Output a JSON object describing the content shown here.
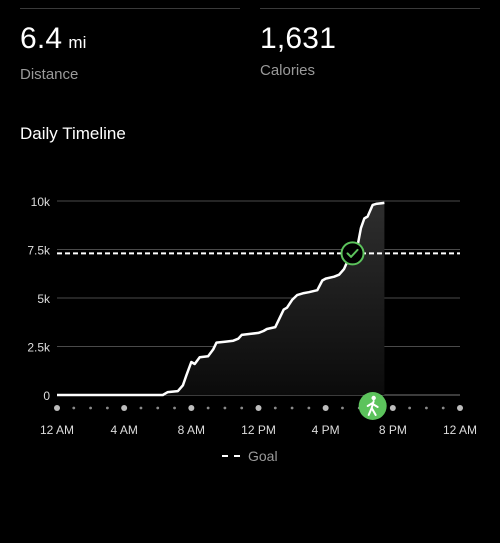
{
  "stats": {
    "distance": {
      "value": "6.4",
      "unit": "mi",
      "label": "Distance"
    },
    "calories": {
      "value": "1,631",
      "label": "Calories"
    }
  },
  "section_title": "Daily Timeline",
  "legend": {
    "goal_label": "Goal"
  },
  "icons": {
    "goal_reached": "check-circle-icon",
    "activity": "walking-icon"
  },
  "colors": {
    "accent": "#5cc35c",
    "line": "#ffffff",
    "grid": "#4a4a4a",
    "muted": "#9a9a9a"
  },
  "chart_data": {
    "type": "area",
    "x_ticks": [
      "12 AM",
      "4 AM",
      "8 AM",
      "12 PM",
      "4 PM",
      "8 PM",
      "12 AM"
    ],
    "x_tick_hours": [
      0,
      4,
      8,
      12,
      16,
      20,
      24
    ],
    "y_ticks": [
      "0",
      "2.5k",
      "5k",
      "7.5k",
      "10k"
    ],
    "y_tick_values": [
      0,
      2500,
      5000,
      7500,
      10000
    ],
    "xlim": [
      0,
      24
    ],
    "ylim": [
      0,
      10000
    ],
    "goal": 7300,
    "goal_reached_hour": 17.6,
    "activity_marker_hour": 18.8,
    "series": [
      {
        "x": [
          0,
          6.3,
          6.6,
          7.2,
          7.5,
          7.7,
          8.0,
          8.2,
          8.5,
          9.0,
          9.3,
          9.5,
          10.0,
          10.5,
          10.8,
          11.0,
          11.5,
          12.0,
          12.3,
          12.5,
          13.0,
          13.5,
          13.7,
          14.0,
          14.3,
          14.5,
          14.7,
          15.0,
          15.5,
          15.8,
          16.0,
          16.5,
          16.8,
          17.1,
          17.3,
          17.6,
          17.9,
          18.1,
          18.3,
          18.5,
          18.8,
          19.0,
          19.5
        ],
        "y": [
          0,
          0,
          150,
          200,
          500,
          1000,
          1700,
          1600,
          1950,
          2000,
          2350,
          2700,
          2750,
          2800,
          2900,
          3100,
          3150,
          3200,
          3300,
          3400,
          3500,
          4400,
          4500,
          4900,
          5150,
          5200,
          5250,
          5300,
          5400,
          5900,
          6000,
          6100,
          6200,
          6500,
          6900,
          7300,
          7700,
          8600,
          9100,
          9200,
          9800,
          9850,
          9900
        ]
      }
    ]
  }
}
